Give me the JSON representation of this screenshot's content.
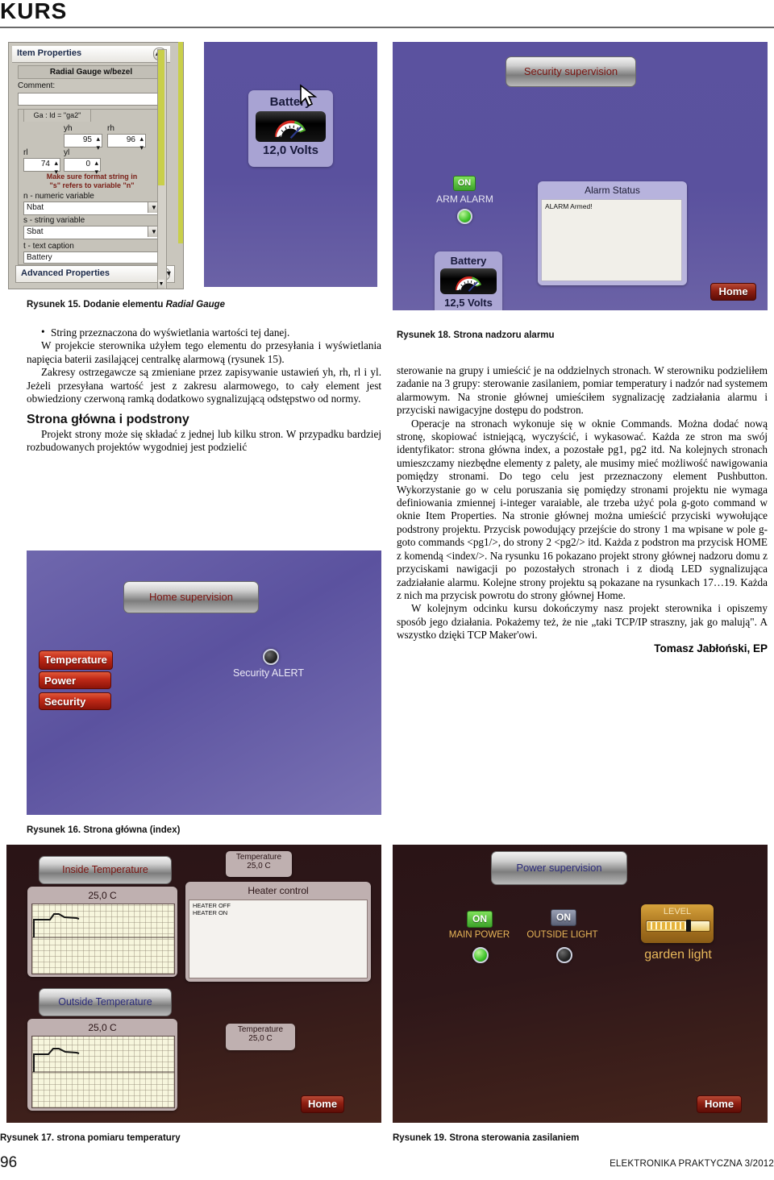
{
  "header": {
    "section": "KURS"
  },
  "fig15": {
    "caption_prefix": "Rysunek 15. Dodanie elementu ",
    "caption_italic": "Radial Gauge",
    "dialog": {
      "title": "Item Properties",
      "collapse_icon": "chevron-up-icon",
      "subtitle": "Radial Gauge w/bezel",
      "comment_label": "Comment:",
      "comment_value": "",
      "tab_label": "Ga : Id = \"ga2\"",
      "fields": [
        {
          "label": "yh",
          "value": "95"
        },
        {
          "label": "rh",
          "value": "96"
        },
        {
          "label": "rl",
          "value": "74"
        },
        {
          "label": "yl",
          "value": "0"
        }
      ],
      "warning_line1": "Make sure format string in",
      "warning_line2": "\"s\" refers to variable \"n\"",
      "n_label": "n - numeric variable",
      "n_value": "Nbat",
      "s_label": "s - string variable",
      "s_value": "Sbat",
      "t_label": "t - text caption",
      "t_value": "Battery",
      "advanced_label": "Advanced Properties",
      "advanced_icon": "chevron-down-icon"
    },
    "preview": {
      "tile_caption": "Battery",
      "tile_value": "12,0 Volts",
      "cursor_icon": "pointer-cursor-icon"
    },
    "colors": {
      "canvas_purple": "#5a519e",
      "warning_red": "#7a2018"
    }
  },
  "fig18": {
    "caption": "Rysunek 18. Strona nadzoru alarmu",
    "title_button": "Security supervision",
    "arm_toggle": "ON",
    "arm_label": "ARM ALARM",
    "arm_led": "led-green-on",
    "battery_caption": "Battery",
    "battery_value": "12,5 Volts",
    "status_title": "Alarm Status",
    "status_lines": [
      "ALARM Armed!"
    ],
    "home_button": "Home"
  },
  "fig16": {
    "caption": "Rysunek 16. Strona główna (index)",
    "title_button": "Home supervision",
    "nav_buttons": [
      "Temperature",
      "Power",
      "Security"
    ],
    "alert_led": "led-dark-off",
    "alert_label": "Security ALERT"
  },
  "fig17": {
    "caption": "Rysunek 17. strona pomiaru temperatury",
    "inside_button": "Inside Temperature",
    "inside_value": "25,0 C",
    "outside_button": "Outside Temperature",
    "outside_value": "25,0 C",
    "temp_box_top": {
      "title": "Temperature",
      "value": "25,0 C"
    },
    "temp_box_bottom": {
      "title": "Temperature",
      "value": "25,0 C"
    },
    "heater_title": "Heater control",
    "heater_lines": [
      "HEATER OFF",
      "HEATER ON"
    ],
    "home_button": "Home"
  },
  "fig19": {
    "caption": "Rysunek 19. Strona sterowania zasilaniem",
    "title_button": "Power supervision",
    "switches": [
      {
        "badge": "ON",
        "label": "MAIN POWER",
        "led": "led-green-on"
      },
      {
        "badge": "ON",
        "label": "OUTSIDE LIGHT",
        "led": "led-dark-off"
      }
    ],
    "slider_title": "LEVEL",
    "slider_label": "garden light",
    "home_button": "Home"
  },
  "left_column": {
    "p_bullet": "String przeznaczona do wyświetlania wartości tej danej.",
    "p1": "W projekcie sterownika użyłem tego elementu do przesyłania i wyświetlania napięcia baterii zasilającej centralkę alarmową (rysunek 15).",
    "p2": "Zakresy ostrzegawcze są zmieniane przez zapisywanie ustawień yh, rh, rl i yl. Jeżeli przesyłana wartość jest z zakresu alarmowego, to cały element jest obwiedziony czerwoną ramką dodatkowo sygnalizującą odstępstwo od normy.",
    "heading": "Strona główna i podstrony",
    "p3": "Projekt strony może się składać z jednej lub kilku stron. W przypadku bardziej rozbudowanych projektów wygodniej jest podzielić"
  },
  "right_column": {
    "p1": "sterowanie na grupy i umieścić je na oddzielnych stronach. W sterowniku podzieliłem zadanie na 3 grupy: sterowanie zasilaniem, pomiar temperatury i nadzór nad systemem alarmowym. Na stronie głównej umieściłem sygnalizację zadziałania alarmu i przyciski nawigacyjne dostępu do podstron.",
    "p2": "Operacje na stronach wykonuje się w oknie Commands. Można dodać nową stronę, skopiować istniejącą, wyczyścić, i wykasować. Każda ze stron ma swój identyfikator: strona główna index, a pozostałe pg1, pg2 itd. Na kolejnych stronach umieszczamy niezbędne elementy z palety, ale musimy mieć możliwość nawigowania pomiędzy stronami. Do tego celu jest przeznaczony element Pushbutton. Wykorzystanie go w celu poruszania się pomiędzy stronami projektu nie wymaga definiowania zmiennej i-integer varaiable, ale trzeba użyć pola g-goto command w oknie Item Properties. Na stronie głównej można umieścić przyciski wywołujące podstrony projektu. Przycisk powodujący przejście do strony 1 ma wpisane w pole g-goto commands <pg1/>, do strony 2 <pg2/> itd. Każda z podstron ma przycisk HOME z komendą <index/>. Na rysunku 16 pokazano projekt strony głównej nadzoru domu z przyciskami nawigacji po pozostałych stronach i z diodą LED sygnalizująca zadziałanie alarmu. Kolejne strony projektu są pokazane na rysunkach 17…19. Każda z nich ma przycisk powrotu do strony głównej Home.",
    "p3": "W kolejnym odcinku kursu dokończymy nasz projekt sterownika i opiszemy sposób jego działania. Pokażemy też, że nie „taki TCP/IP straszny, jak go malują\". A wszystko dzięki TCP Maker'owi.",
    "author": "Tomasz Jabłoński, EP"
  },
  "footer": {
    "page": "96",
    "magazine": "ELEKTRONIKA PRAKTYCZNA 3/2012"
  }
}
